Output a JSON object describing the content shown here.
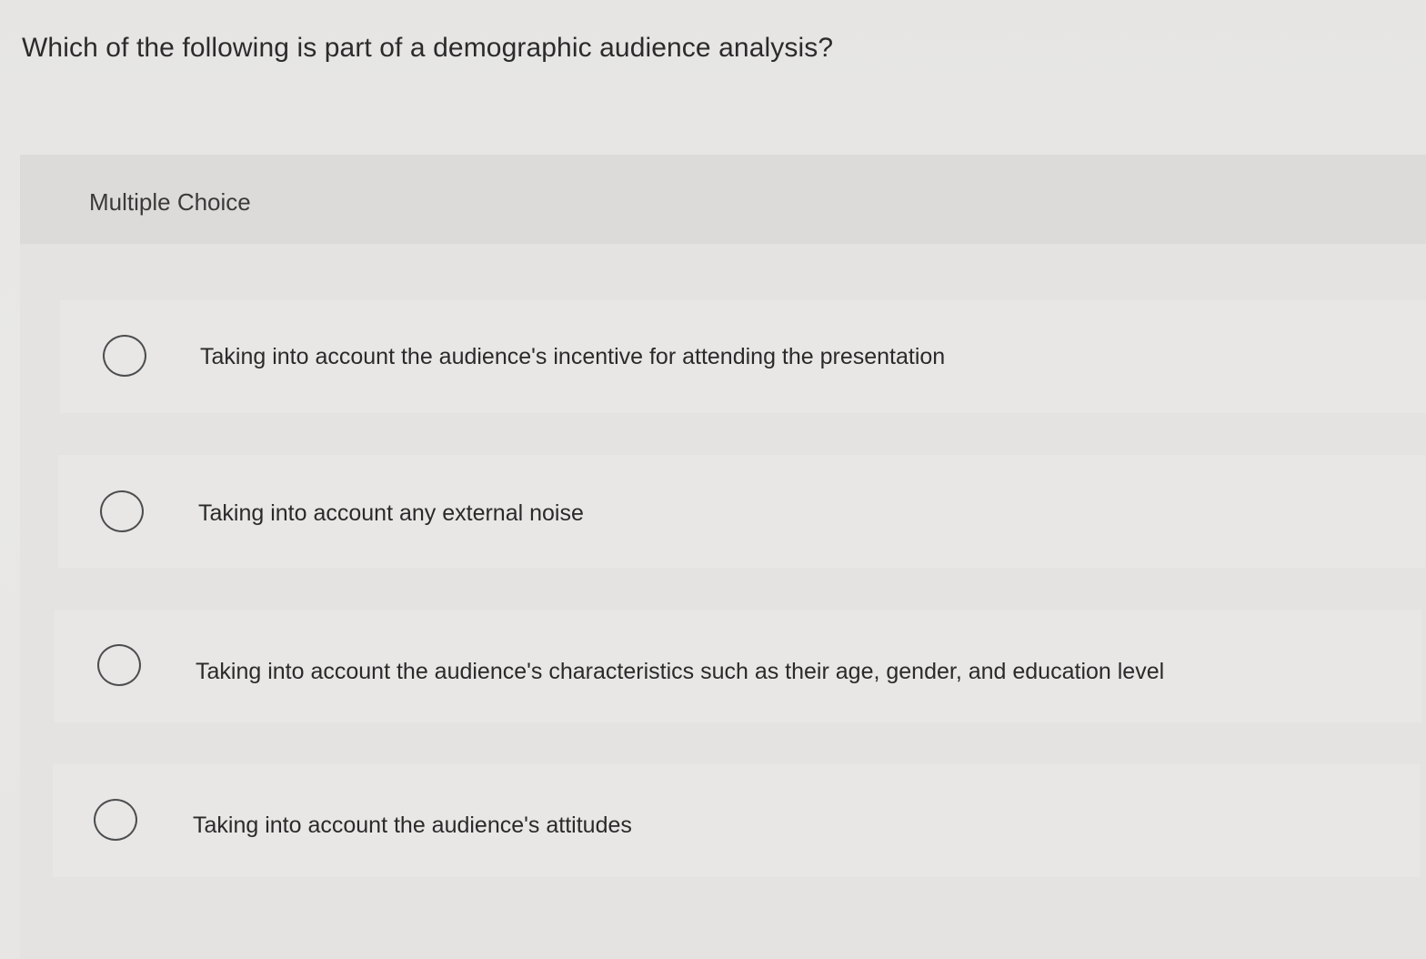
{
  "question": {
    "text": "Which of the following is part of a demographic audience analysis?"
  },
  "question_type": {
    "label": "Multiple Choice"
  },
  "options": [
    {
      "label": "Taking into account the audience's incentive for attending the presentation",
      "selected": false
    },
    {
      "label": "Taking into account any external noise",
      "selected": false
    },
    {
      "label": "Taking into account the audience's characteristics such as their age, gender, and education level",
      "selected": false
    },
    {
      "label": "Taking into account the audience's attitudes",
      "selected": false
    }
  ],
  "colors": {
    "background": "#e7e6e4",
    "header_band": "#dcdbd9",
    "option_bg": "#e8e7e5",
    "radio_border": "#4c4d4f",
    "text": "#2a2a2a"
  }
}
